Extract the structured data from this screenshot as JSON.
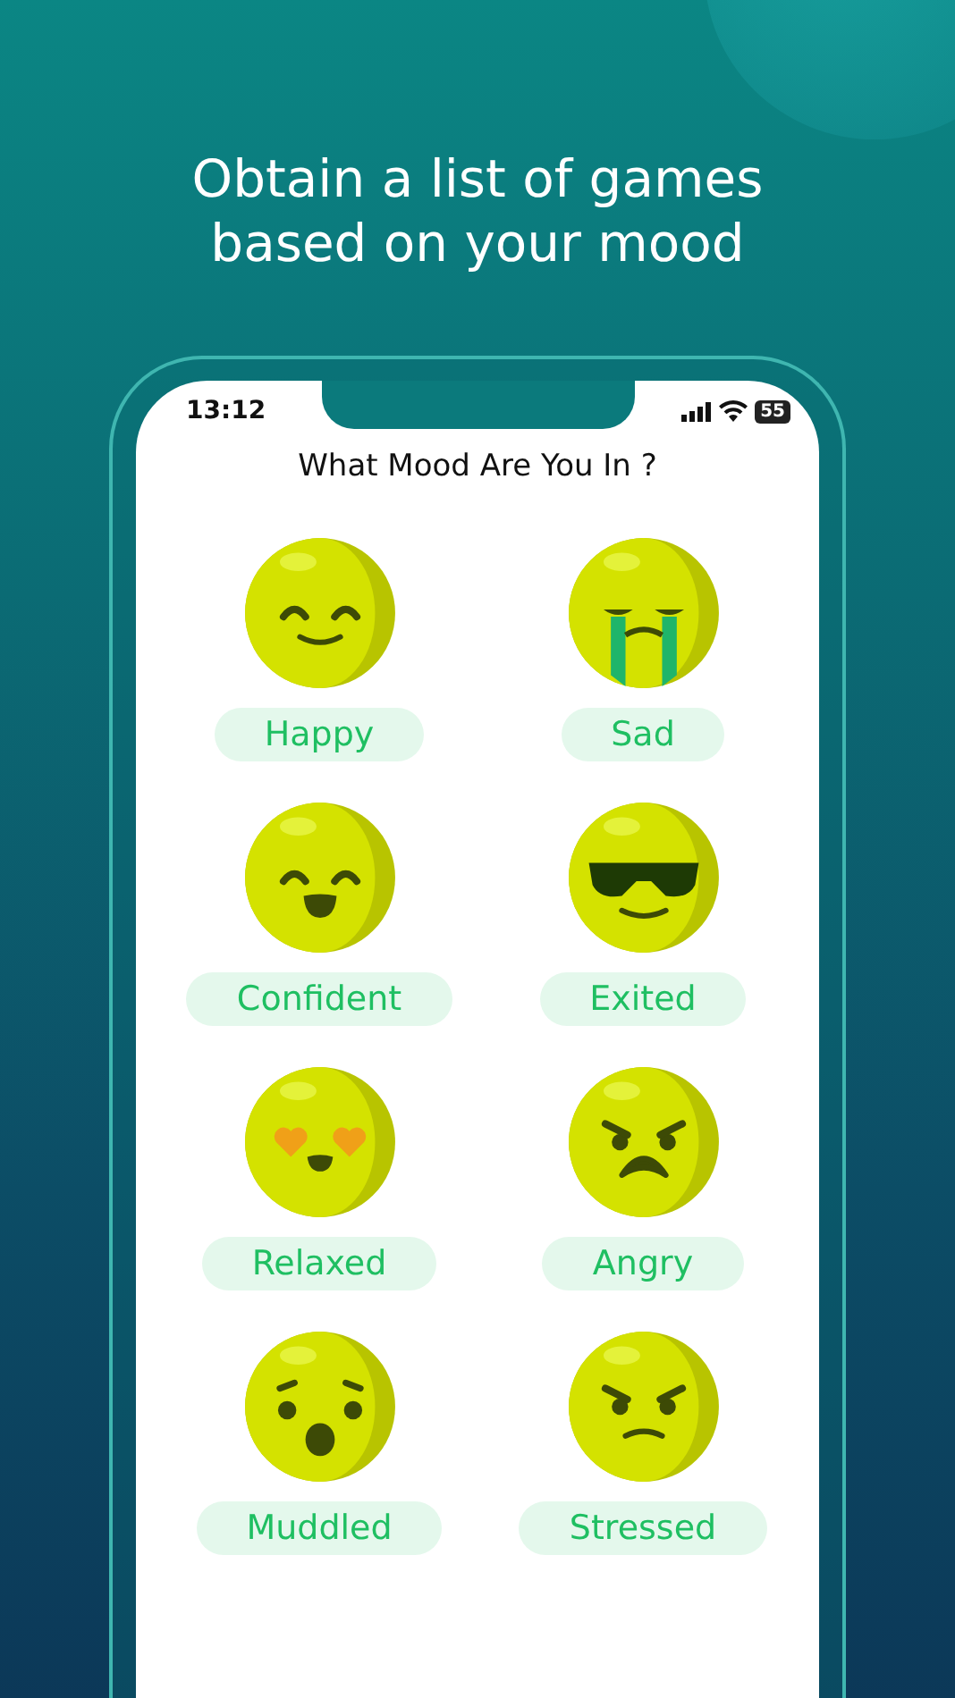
{
  "headline": "Obtain a list of games based on your mood",
  "status_bar": {
    "time": "13:12",
    "battery": "55"
  },
  "screen_title": "What Mood Are You In ?",
  "moods": [
    {
      "label": "Happy",
      "kind": "smile"
    },
    {
      "label": "Sad",
      "kind": "cry"
    },
    {
      "label": "Confident",
      "kind": "laugh"
    },
    {
      "label": "Exited",
      "kind": "cool"
    },
    {
      "label": "Relaxed",
      "kind": "love"
    },
    {
      "label": "Angry",
      "kind": "angry"
    },
    {
      "label": "Muddled",
      "kind": "shocked"
    },
    {
      "label": "Stressed",
      "kind": "frown"
    }
  ]
}
